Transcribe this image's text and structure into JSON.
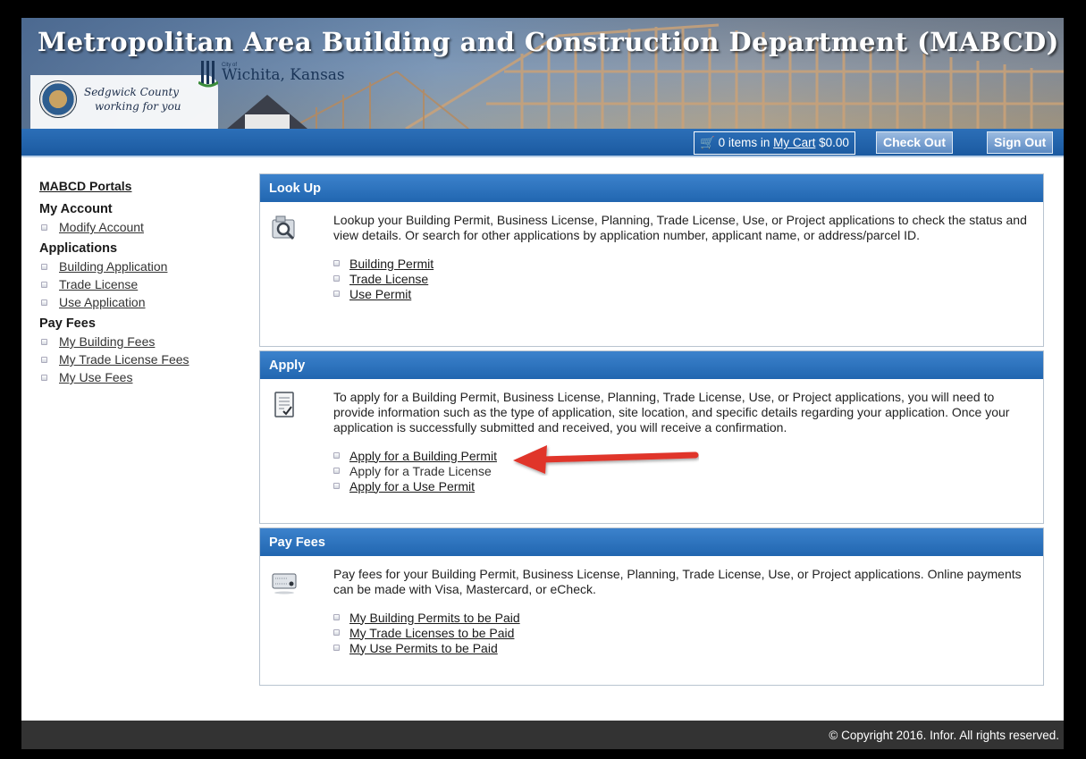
{
  "header": {
    "title": "Metropolitan Area Building and Construction Department (MABCD)",
    "sedgwick_line1": "Sedgwick County",
    "sedgwick_line2": "working for you",
    "wichita_cityof": "City of",
    "wichita_name": "Wichita, Kansas"
  },
  "toolbar": {
    "cart_prefix": "0 items in",
    "cart_link": "My Cart",
    "cart_total": "$0.00",
    "checkout_label": "Check Out",
    "signout_label": "Sign Out"
  },
  "sidebar": {
    "portals_label": "MABCD Portals",
    "sections": [
      {
        "heading": "My Account",
        "items": [
          "Modify Account"
        ]
      },
      {
        "heading": "Applications",
        "items": [
          "Building Application",
          "Trade License",
          "Use Application"
        ]
      },
      {
        "heading": "Pay Fees",
        "items": [
          "My Building Fees",
          "My Trade License Fees",
          "My Use Fees"
        ]
      }
    ]
  },
  "panels": {
    "lookup": {
      "title": "Look Up",
      "icon": "magnifier-icon",
      "desc": "Lookup your Building Permit, Business License, Planning, Trade License, Use, or Project applications to check the status and view details. Or search for other applications by application number, applicant name, or address/parcel ID.",
      "links": [
        "Building Permit",
        "Trade License",
        "Use Permit"
      ]
    },
    "apply": {
      "title": "Apply",
      "icon": "form-check-icon",
      "desc": "To apply for a Building Permit, Business License, Planning, Trade License, Use, or Project applications, you will need to provide information such as the type of application, site location, and specific details regarding your application. Once your application is successfully submitted and received, you will receive a confirmation.",
      "links": [
        "Apply for a Building Permit",
        "Apply for a Trade License",
        "Apply for a Use Permit"
      ]
    },
    "pay": {
      "title": "Pay Fees",
      "icon": "payment-card-icon",
      "desc": "Pay fees for your Building Permit, Business License, Planning, Trade License, Use, or Project applications. Online payments can be made with Visa, Mastercard, or eCheck.",
      "links": [
        "My Building Permits to be Paid",
        "My Trade Licenses to be Paid",
        "My Use Permits to be Paid"
      ]
    }
  },
  "footer": {
    "copyright": "© Copyright 2016. Infor. All rights reserved."
  },
  "colors": {
    "header_blue": "#1b5aa0",
    "panel_header": "#2c74bf",
    "arrow_red": "#e0342c",
    "footer_bg": "#333333"
  }
}
